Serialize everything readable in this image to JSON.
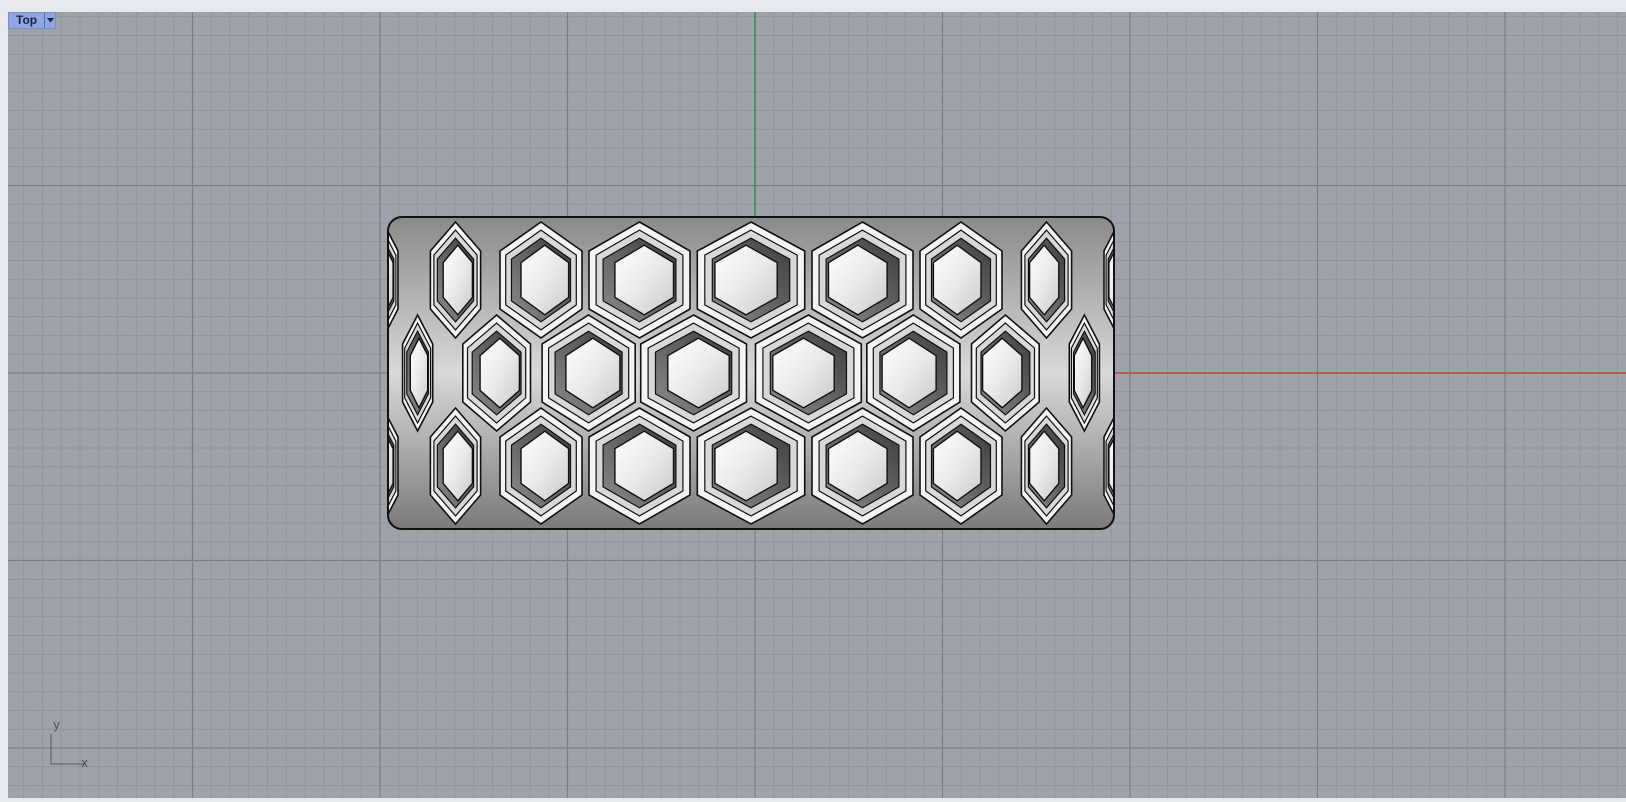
{
  "viewport": {
    "name": "Top",
    "dropdown_icon": "caret-down-icon",
    "colors": {
      "background": "#9ea3aa",
      "minor_grid": "#8d9299",
      "major_grid": "#7a7f86",
      "x_axis": "#c0392b",
      "y_axis": "#1e8a3a",
      "tab_background": "#8ea6e6",
      "model_surface": "#f2f2f2",
      "model_shadow": "#5e5e5e",
      "model_edge": "#111111"
    }
  },
  "axis_widget": {
    "x_label": "x",
    "y_label": "y"
  },
  "model": {
    "description_icon": "honeycomb-ring-model",
    "rows": 3
  }
}
